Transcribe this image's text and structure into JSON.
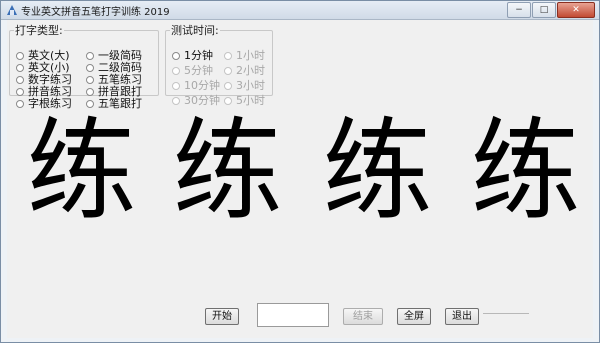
{
  "window": {
    "title": "专业英文拼音五笔打字训练 2019",
    "minimize_glyph": "−",
    "maximize_glyph": "□",
    "close_glyph": "✕"
  },
  "typing_type": {
    "legend": "打字类型:",
    "options": [
      {
        "label": "英文(大)"
      },
      {
        "label": "英文(小)"
      },
      {
        "label": "数字练习"
      },
      {
        "label": "拼音练习"
      },
      {
        "label": "字根练习"
      },
      {
        "label": "一级简码"
      },
      {
        "label": "二级简码"
      },
      {
        "label": "五笔练习"
      },
      {
        "label": "拼音跟打"
      },
      {
        "label": "五笔跟打"
      }
    ]
  },
  "test_time": {
    "legend": "测试时间:",
    "options": [
      {
        "label": "1分钟",
        "enabled": true
      },
      {
        "label": "5分钟",
        "enabled": false
      },
      {
        "label": "10分钟",
        "enabled": false
      },
      {
        "label": "30分钟",
        "enabled": false
      },
      {
        "label": "1小时",
        "enabled": false
      },
      {
        "label": "2小时",
        "enabled": false
      },
      {
        "label": "3小时",
        "enabled": false
      },
      {
        "label": "5小时",
        "enabled": false
      }
    ]
  },
  "practice": {
    "characters": [
      "练",
      "练",
      "练",
      "练"
    ]
  },
  "controls": {
    "start_label": "开始",
    "input_value": "",
    "end_label": "结束",
    "fullscreen_label": "全屏",
    "exit_label": "退出"
  }
}
